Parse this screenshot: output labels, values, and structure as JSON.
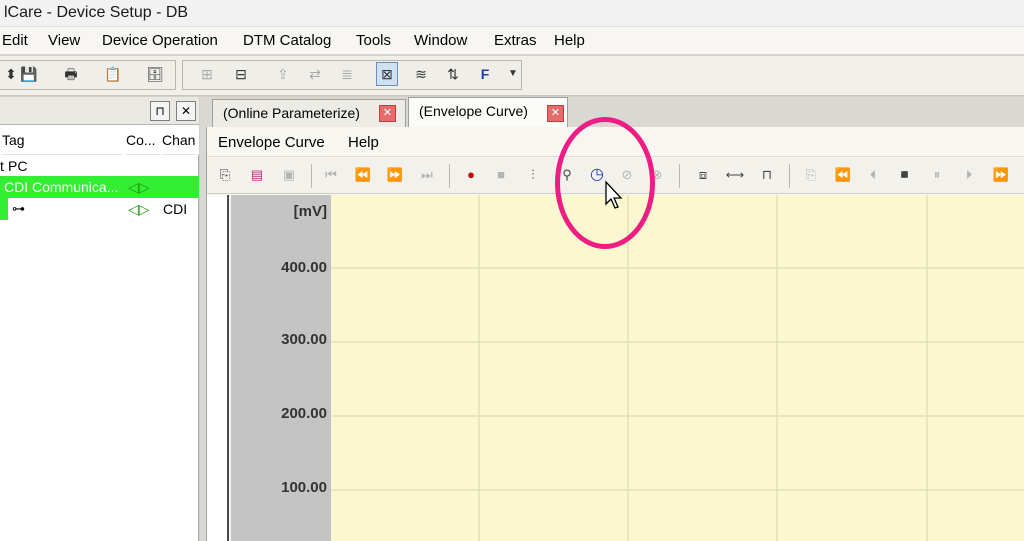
{
  "window": {
    "title": "lCare - Device Setup - DB"
  },
  "menubar": [
    "Edit",
    "View",
    "Device Operation",
    "DTM Catalog",
    "Tools",
    "Window",
    "Extras",
    "Help"
  ],
  "left_panel": {
    "pin": "⊓",
    "close": "✕",
    "columns": [
      "Tag",
      "Co...",
      "Chan"
    ],
    "tree": [
      {
        "label": "PC"
      },
      {
        "label": "CDI Communica...",
        "status": "◁▷"
      },
      {
        "label": "",
        "status": "◁▷",
        "channel": "CDI"
      }
    ]
  },
  "tabs": [
    {
      "label": "(Online Parameterize)"
    },
    {
      "label": "(Envelope Curve)"
    }
  ],
  "inner_menu": [
    "Envelope Curve",
    "Help"
  ],
  "chart": {
    "unit_label": "[mV]",
    "y_ticks": [
      "400.00",
      "300.00",
      "200.00",
      "100.00"
    ]
  },
  "colors": {
    "highlight": "#ee1c83",
    "plot_bg": "#fbf8cf",
    "selected_row": "#33ee33"
  }
}
